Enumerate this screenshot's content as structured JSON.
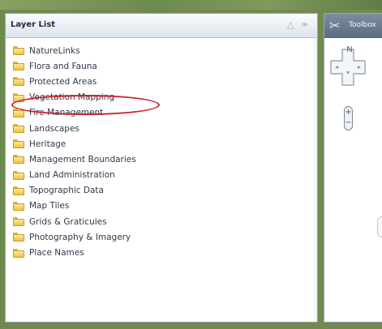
{
  "layer_panel": {
    "title": "Layer List",
    "items": [
      {
        "label": "NatureLinks"
      },
      {
        "label": "Flora and Fauna"
      },
      {
        "label": "Protected Areas"
      },
      {
        "label": "Vegetation Mapping",
        "highlighted": true
      },
      {
        "label": "Fire Management"
      },
      {
        "label": "Landscapes"
      },
      {
        "label": "Heritage"
      },
      {
        "label": "Management Boundaries"
      },
      {
        "label": "Land Administration"
      },
      {
        "label": "Topographic Data"
      },
      {
        "label": "Map Tiles"
      },
      {
        "label": "Grids & Graticules"
      },
      {
        "label": "Photography & Imagery"
      },
      {
        "label": "Place Names"
      }
    ],
    "icons": {
      "folder": "folder-icon",
      "collapse_up": "chevron-up-icon",
      "collapse_panel": "double-chevron-right-icon"
    }
  },
  "tool_panel": {
    "title": "Toolbox",
    "nav_north_label": "N",
    "zoom_in_label": "+",
    "zoom_out_label": "−",
    "icons": {
      "tools": "wrench-screwdriver-icon",
      "pan": "pan-arrows-icon"
    }
  },
  "annotation": {
    "color": "#c8202c"
  }
}
